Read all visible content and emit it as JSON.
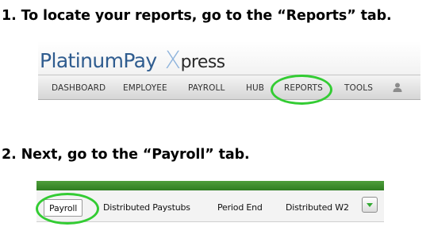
{
  "step1": {
    "text": "1. To locate your reports, go to the “Reports” tab."
  },
  "step2": {
    "text": "2. Next, go to the “Payroll” tab."
  },
  "platinumpay": {
    "logo": {
      "brand": "PlatinumPay",
      "x": "X",
      "rest": "press"
    },
    "nav": [
      {
        "label": "DASHBOARD"
      },
      {
        "label": "EMPLOYEE"
      },
      {
        "label": "PAYROLL"
      },
      {
        "label": "HUB"
      },
      {
        "label": "REPORTS",
        "highlighted": true
      },
      {
        "label": "TOOLS"
      }
    ],
    "user_icon": "user-icon"
  },
  "payroll_tabs": {
    "tabs": [
      {
        "label": "Payroll",
        "active": true,
        "highlighted": true
      },
      {
        "label": "Distributed Paystubs"
      },
      {
        "label": "Period End"
      },
      {
        "label": "Distributed W2"
      }
    ],
    "more_icon": "chevron-down-icon"
  },
  "colors": {
    "highlight": "#33cc33",
    "brand_blue": "#2f5c8f",
    "brand_x": "#8fb4dc",
    "green_bar": "#3a8a2b"
  }
}
